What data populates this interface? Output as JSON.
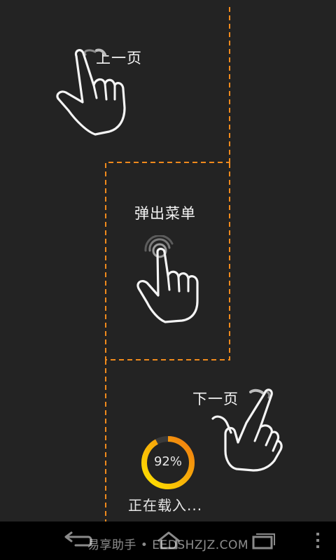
{
  "guide": {
    "prev_page_label": "上一页",
    "menu_label": "弹出菜单",
    "next_page_label": "下一页"
  },
  "loading": {
    "percent": 92,
    "percent_text": "92%",
    "status_text": "正在载入..."
  },
  "icons": {
    "prev_gesture": "swipe-up-hand-icon",
    "menu_gesture": "tap-hand-icon",
    "next_gesture": "swipe-down-hand-icon",
    "nav_back": "back-arrow-icon",
    "nav_home": "home-icon",
    "nav_recent": "recent-apps-icon",
    "nav_menu": "overflow-menu-icon"
  },
  "colors": {
    "background": "#232323",
    "divider": "#f08a1c",
    "ring_start": "#ffe600",
    "ring_end": "#f07a10"
  },
  "watermark": "易享助手 • EEDSHZJZ.COM"
}
